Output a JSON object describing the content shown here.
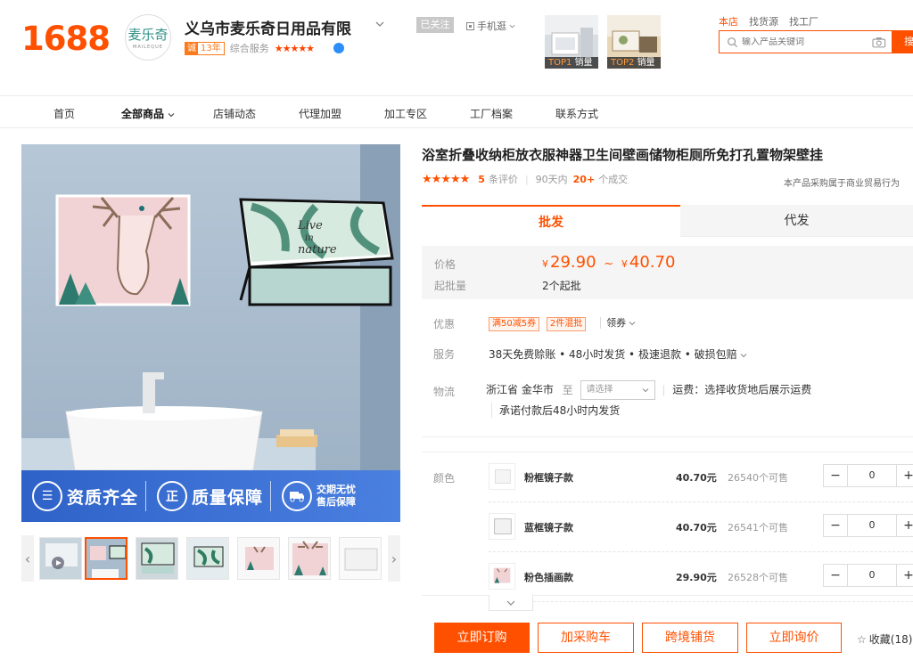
{
  "header": {
    "logo_text": "1688",
    "shop": {
      "logo_glyph": "麦乐奇",
      "logo_sub": "MAILEQUE",
      "name": "义乌市麦乐奇日用品有限",
      "years_badge_icon": "诚",
      "years": "13年",
      "score_label": "综合服务",
      "score_stars": "★★★★★",
      "follow_label": "已关注",
      "mobile_label": "手机逛"
    },
    "top_items": [
      {
        "rank": "TOP1",
        "label": "销量"
      },
      {
        "rank": "TOP2",
        "label": "销量"
      }
    ],
    "search": {
      "tabs": [
        "本店",
        "找货源",
        "找工厂"
      ],
      "placeholder": "输入产品关键词",
      "button_label": "搜索"
    }
  },
  "nav": {
    "items": [
      "首页",
      "全部商品",
      "店铺动态",
      "代理加盟",
      "加工专区",
      "工厂档案",
      "联系方式"
    ]
  },
  "gallery": {
    "main_image_text": "Live in nature",
    "banner": {
      "item1_icon": "☰",
      "item1": "资质齐全",
      "item2_icon": "正",
      "item2": "质量保障",
      "item3_line1": "交期无忧",
      "item3_line2": "售后保障"
    },
    "thumb_prev": "‹",
    "thumb_next": "›"
  },
  "product": {
    "title": "浴室折叠收纳柜放衣服神器卫生间壁画储物柜厕所免打孔置物架壁挂",
    "rating_stars": "★★★★★",
    "review_count": "5",
    "review_label": "条评价",
    "sales_period": "90天内",
    "sales_count": "20+",
    "sales_label": "个成交",
    "biz_note": "本产品采购属于商业贸易行为",
    "tabs": {
      "active": "批发",
      "inactive": "代发"
    },
    "price": {
      "label": "价格",
      "currency": "¥",
      "low": "29.90",
      "range_sep": "~",
      "high": "40.70",
      "moq_label": "起批量",
      "moq_value": "2个起批"
    },
    "promo": {
      "label": "优惠",
      "tags": [
        "满50减5券",
        "2件混批"
      ],
      "coupon": "领券"
    },
    "service": {
      "label": "服务",
      "value": "38天免费赊账 • 48小时发货 • 极速退款 • 破损包赔"
    },
    "logistics": {
      "label": "物流",
      "origin": "浙江省 金华市",
      "to": "至",
      "select_placeholder": "请选择",
      "freight": "运费：选择收货地后展示运费",
      "ship_promise": "承诺付款后48小时内发货"
    },
    "sku": {
      "label": "颜色",
      "items": [
        {
          "name": "粉框镜子款",
          "price": "40.70元",
          "stock": "26540个可售",
          "qty": "0"
        },
        {
          "name": "蓝框镜子款",
          "price": "40.70元",
          "stock": "26541个可售",
          "qty": "0"
        },
        {
          "name": "粉色插画款",
          "price": "29.90元",
          "stock": "26528个可售",
          "qty": "0"
        }
      ],
      "minus": "−",
      "plus": "+"
    },
    "actions": {
      "order": "立即订购",
      "cart": "加采购车",
      "crossborder": "跨境铺货",
      "inquiry": "立即询价",
      "favorite_icon": "☆",
      "favorite": "收藏(18)"
    }
  }
}
